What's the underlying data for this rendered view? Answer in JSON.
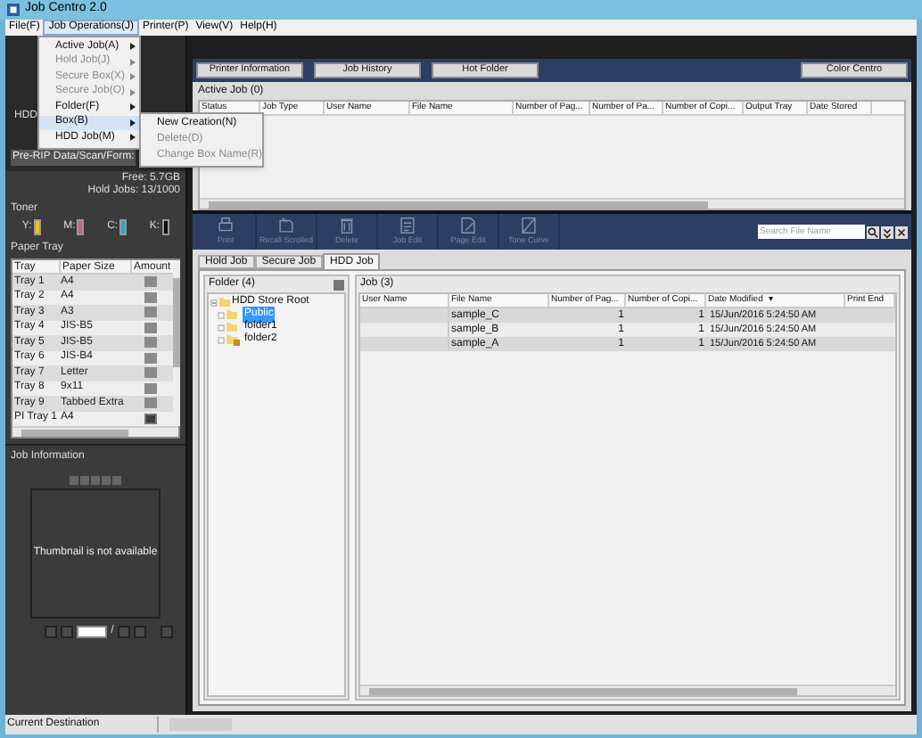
{
  "window": {
    "title": "Job Centro 2.0"
  },
  "menu_bar": [
    {
      "label": "File(F)",
      "selected": false
    },
    {
      "label": "Job Operations(J)",
      "selected": true
    },
    {
      "label": "Printer(P)",
      "selected": false
    },
    {
      "label": "View(V)",
      "selected": false
    },
    {
      "label": "Help(H)",
      "selected": false
    }
  ],
  "open_menu": [
    {
      "label": "Active Job(A)",
      "disabled": false,
      "selected": false
    },
    {
      "label": "Hold Job(J)",
      "disabled": true,
      "selected": false
    },
    {
      "label": "Secure Box(X)",
      "disabled": true,
      "selected": false
    },
    {
      "label": "Secure Job(O)",
      "disabled": true,
      "selected": false
    },
    {
      "label": "Folder(F)",
      "disabled": false,
      "selected": false
    },
    {
      "label": "Box(B)",
      "disabled": false,
      "selected": true
    },
    {
      "label": "HDD Job(M)",
      "disabled": false,
      "selected": false
    }
  ],
  "submenu": [
    {
      "label": "New Creation(N)",
      "disabled": false
    },
    {
      "label": "Delete(D)",
      "disabled": true
    },
    {
      "label": "Change Box Name(R)",
      "disabled": true
    }
  ],
  "storage": {
    "hdd_label": "HDD",
    "detail": "Pre-RIP Data/Scan/Form:",
    "free": "Free: 5.7GB",
    "hold_jobs": "Hold Jobs: 13/1000"
  },
  "toner": {
    "title": "Toner",
    "items": [
      {
        "label": "Y:",
        "color": "#f2c31a"
      },
      {
        "label": "M:",
        "color": "#d25b8c"
      },
      {
        "label": "C:",
        "color": "#27a9c4"
      },
      {
        "label": "K:",
        "color": "#0a0a0a"
      }
    ]
  },
  "paper_tray": {
    "title": "Paper Tray",
    "columns": [
      "Tray",
      "Paper Size",
      "Amount"
    ],
    "rows": [
      {
        "tray": "Tray 1",
        "size": "A4",
        "low": false
      },
      {
        "tray": "Tray 2",
        "size": "A4",
        "low": false
      },
      {
        "tray": "Tray 3",
        "size": "A3",
        "low": false
      },
      {
        "tray": "Tray 4",
        "size": "JIS-B5",
        "low": false
      },
      {
        "tray": "Tray 5",
        "size": "JIS-B5",
        "low": false
      },
      {
        "tray": "Tray 6",
        "size": "JIS-B4",
        "low": false
      },
      {
        "tray": "Tray 7",
        "size": "Letter",
        "low": false
      },
      {
        "tray": "Tray 8",
        "size": "9x11",
        "low": false
      },
      {
        "tray": "Tray 9",
        "size": "Tabbed Extra",
        "low": false
      },
      {
        "tray": "PI Tray 1",
        "size": "A4",
        "low": true
      }
    ]
  },
  "job_information": {
    "title": "Job Information",
    "thumbnail": "Thumbnail is not available",
    "page_separator": "/"
  },
  "top_buttons": [
    "Printer Information",
    "Job History",
    "Hot Folder",
    "Color Centro"
  ],
  "active_job": {
    "title": "Active Job (0)",
    "columns": [
      "Status",
      "Job Type",
      "User Name",
      "File Name",
      "Number of Pag...",
      "Number of Pa...",
      "Number of Copi...",
      "Output Tray",
      "Date Stored"
    ]
  },
  "toolbar": [
    {
      "label": "Print",
      "disabled": true
    },
    {
      "label": "Recall Scrolled",
      "disabled": true
    },
    {
      "label": "Delete",
      "disabled": true
    },
    {
      "label": "Job Edit",
      "disabled": true
    },
    {
      "label": "Page Edit",
      "disabled": true
    },
    {
      "label": "Tone Curve",
      "disabled": true
    }
  ],
  "search": {
    "placeholder": "Search File Name"
  },
  "tabs": [
    {
      "label": "Hold Job",
      "selected": false
    },
    {
      "label": "Secure Job",
      "selected": false
    },
    {
      "label": "HDD Job",
      "selected": true
    }
  ],
  "folder_panel": {
    "title": "Folder (4)",
    "tree": [
      {
        "label": "HDD Store Root",
        "selected": false,
        "expanded": true,
        "children": [
          {
            "label": "Public",
            "selected": true,
            "locked": false
          },
          {
            "label": "folder1",
            "selected": false,
            "locked": false
          },
          {
            "label": "folder2",
            "selected": false,
            "locked": true
          }
        ]
      }
    ]
  },
  "job_panel": {
    "title": "Job (3)",
    "columns": [
      {
        "label": "User Name"
      },
      {
        "label": "File Name"
      },
      {
        "label": "Number of Pag..."
      },
      {
        "label": "Number of Copi..."
      },
      {
        "label": "Date Modified",
        "sort_mark": "▾"
      },
      {
        "label": "Print End"
      }
    ],
    "rows": [
      {
        "file_name": "sample_C",
        "pages": "1",
        "copies": "1",
        "date_modified": "15/Jun/2016 5:24:50 AM"
      },
      {
        "file_name": "sample_B",
        "pages": "1",
        "copies": "1",
        "date_modified": "15/Jun/2016 5:24:50 AM"
      },
      {
        "file_name": "sample_A",
        "pages": "1",
        "copies": "1",
        "date_modified": "15/Jun/2016 5:24:50 AM"
      }
    ]
  },
  "status_bar": {
    "label": "Current Destination"
  }
}
